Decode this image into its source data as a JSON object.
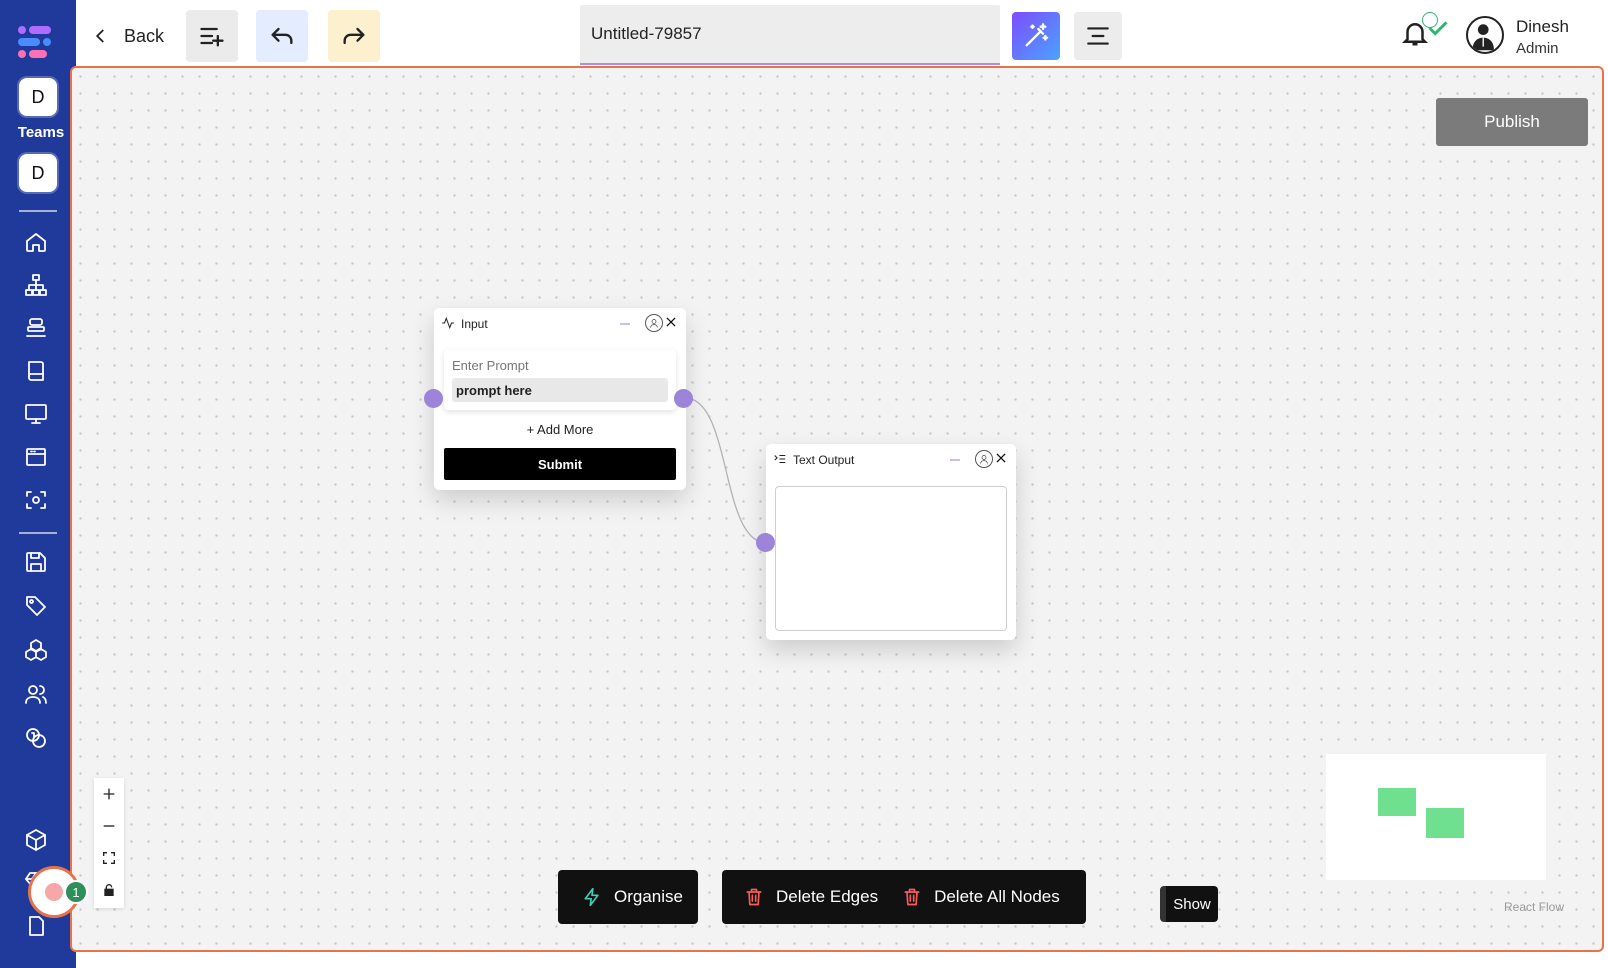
{
  "sidebar": {
    "team_initial_1": "D",
    "teams_label": "Teams",
    "team_initial_2": "D",
    "nav_icons": [
      "home-icon",
      "sitemap-icon",
      "database-icon",
      "book-icon",
      "monitor-icon",
      "browser-window-icon",
      "scan-icon",
      "save-icon",
      "tag-icon",
      "cubes-icon",
      "users-icon",
      "coins-icon",
      "package-icon",
      "diamond-icon",
      "document-icon"
    ],
    "brand_color": "#1f3a9b"
  },
  "topbar": {
    "back_label": "Back",
    "title_value": "Untitled-79857",
    "user_name": "Dinesh",
    "user_role": "Admin"
  },
  "canvas": {
    "publish_label": "Publish",
    "accent_border": "#e8734a"
  },
  "nodes": {
    "input": {
      "title": "Input",
      "prompt_label": "Enter Prompt",
      "prompt_value": "prompt here",
      "add_more_label": "+ Add More",
      "submit_label": "Submit"
    },
    "output": {
      "title": "Text Output"
    }
  },
  "bottom": {
    "organise_label": "Organise",
    "delete_edges_label": "Delete Edges",
    "delete_nodes_label": "Delete All Nodes",
    "show_label": "Show",
    "attribution": "React Flow"
  },
  "recorder": {
    "badge_count": "1"
  }
}
